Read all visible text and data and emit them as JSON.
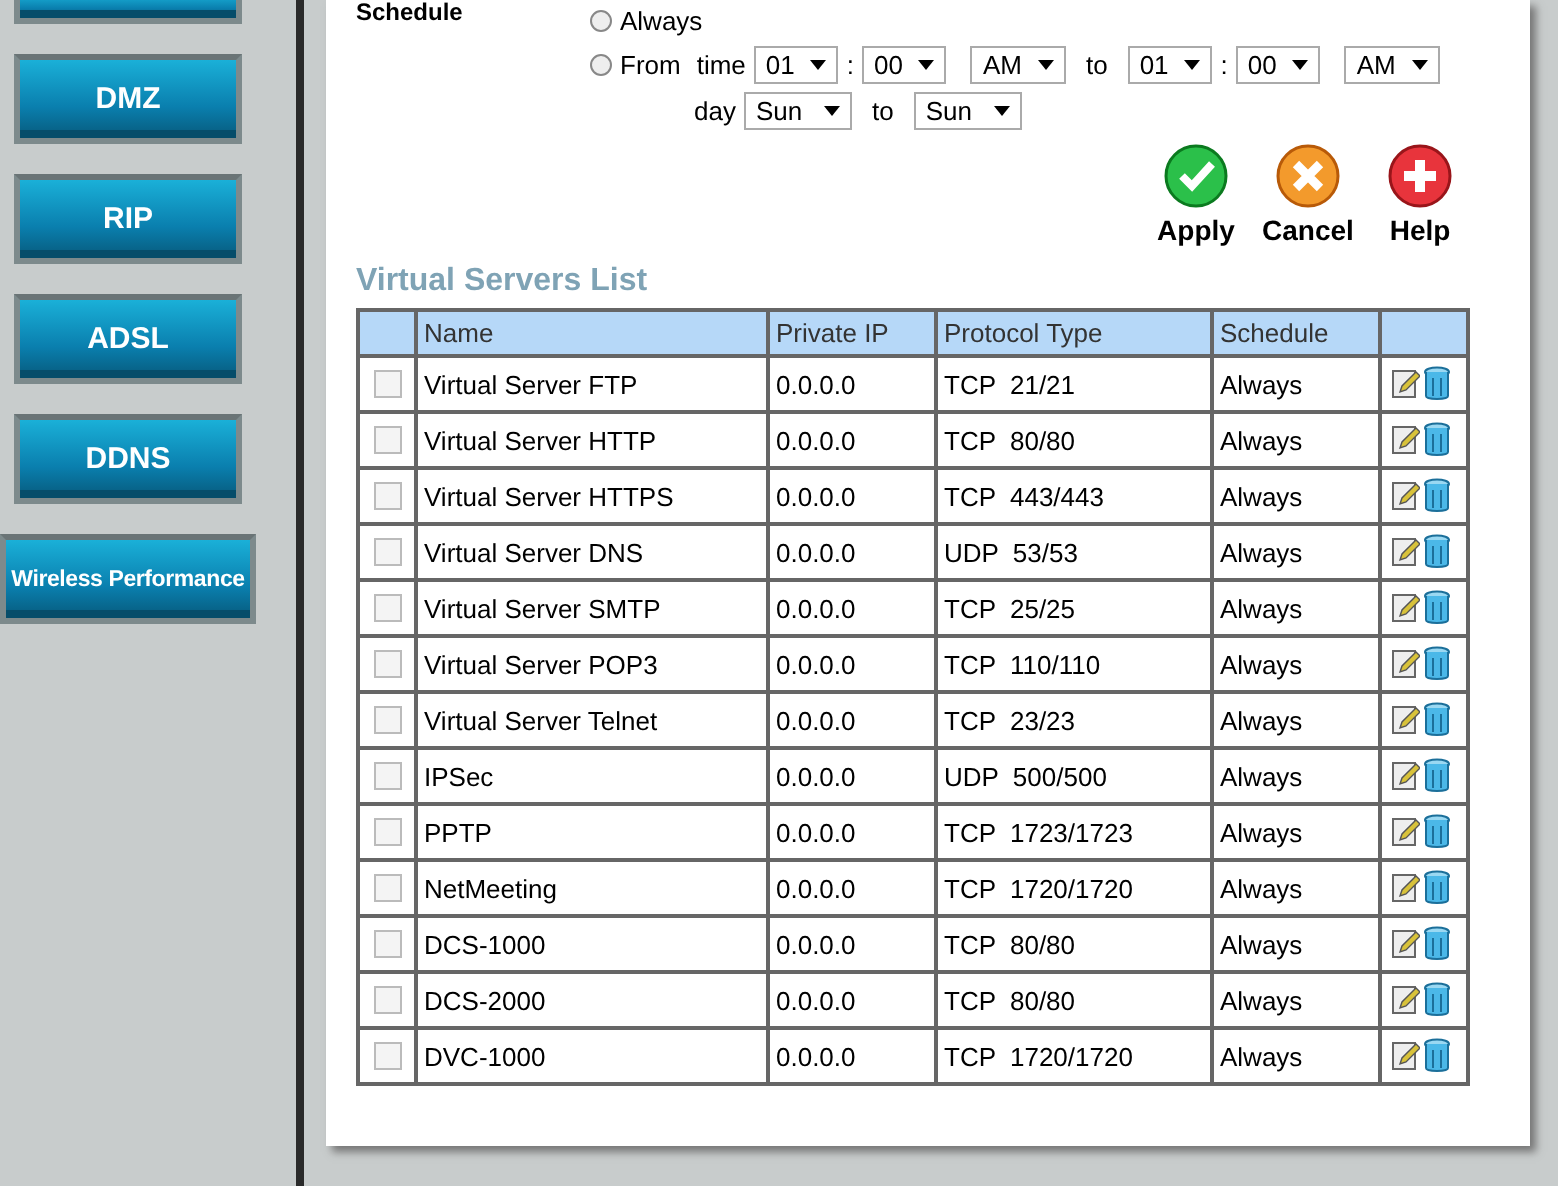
{
  "sidebar": {
    "items": [
      {
        "label": "DMZ"
      },
      {
        "label": "RIP"
      },
      {
        "label": "ADSL"
      },
      {
        "label": "DDNS"
      },
      {
        "label": "Wireless Performance"
      }
    ]
  },
  "schedule": {
    "label": "Schedule",
    "options": [
      {
        "label": "Always",
        "selected": false
      },
      {
        "label": "From",
        "selected": false
      }
    ],
    "time_label": "time",
    "start": {
      "hour": "01",
      "sep": ":",
      "minute": "00",
      "ampm": "AM"
    },
    "to_label": "to",
    "end": {
      "hour": "01",
      "sep": ":",
      "minute": "00",
      "ampm": "AM"
    },
    "day_label": "day",
    "day_start": "Sun",
    "day_to_label": "to",
    "day_end": "Sun"
  },
  "actions": [
    {
      "label": "Apply",
      "kind": "apply"
    },
    {
      "label": "Cancel",
      "kind": "cancel"
    },
    {
      "label": "Help",
      "kind": "help"
    }
  ],
  "table": {
    "title": "Virtual Servers List",
    "columns": [
      "Name",
      "Private IP",
      "Protocol Type",
      "Schedule"
    ],
    "rows": [
      {
        "checked": false,
        "name": "Virtual Server FTP",
        "ip": "0.0.0.0",
        "protocol": "TCP  21/21",
        "schedule": "Always"
      },
      {
        "checked": false,
        "name": "Virtual Server HTTP",
        "ip": "0.0.0.0",
        "protocol": "TCP  80/80",
        "schedule": "Always"
      },
      {
        "checked": false,
        "name": "Virtual Server HTTPS",
        "ip": "0.0.0.0",
        "protocol": "TCP  443/443",
        "schedule": "Always"
      },
      {
        "checked": false,
        "name": "Virtual Server DNS",
        "ip": "0.0.0.0",
        "protocol": "UDP  53/53",
        "schedule": "Always"
      },
      {
        "checked": false,
        "name": "Virtual Server SMTP",
        "ip": "0.0.0.0",
        "protocol": "TCP  25/25",
        "schedule": "Always"
      },
      {
        "checked": false,
        "name": "Virtual Server POP3",
        "ip": "0.0.0.0",
        "protocol": "TCP  110/110",
        "schedule": "Always"
      },
      {
        "checked": false,
        "name": "Virtual Server Telnet",
        "ip": "0.0.0.0",
        "protocol": "TCP  23/23",
        "schedule": "Always"
      },
      {
        "checked": false,
        "name": "IPSec",
        "ip": "0.0.0.0",
        "protocol": "UDP  500/500",
        "schedule": "Always"
      },
      {
        "checked": false,
        "name": "PPTP",
        "ip": "0.0.0.0",
        "protocol": "TCP  1723/1723",
        "schedule": "Always"
      },
      {
        "checked": false,
        "name": "NetMeeting",
        "ip": "0.0.0.0",
        "protocol": "TCP  1720/1720",
        "schedule": "Always"
      },
      {
        "checked": false,
        "name": "DCS-1000",
        "ip": "0.0.0.0",
        "protocol": "TCP  80/80",
        "schedule": "Always"
      },
      {
        "checked": false,
        "name": "DCS-2000",
        "ip": "0.0.0.0",
        "protocol": "TCP  80/80",
        "schedule": "Always"
      },
      {
        "checked": false,
        "name": "DVC-1000",
        "ip": "0.0.0.0",
        "protocol": "TCP  1720/1720",
        "schedule": "Always"
      }
    ]
  }
}
